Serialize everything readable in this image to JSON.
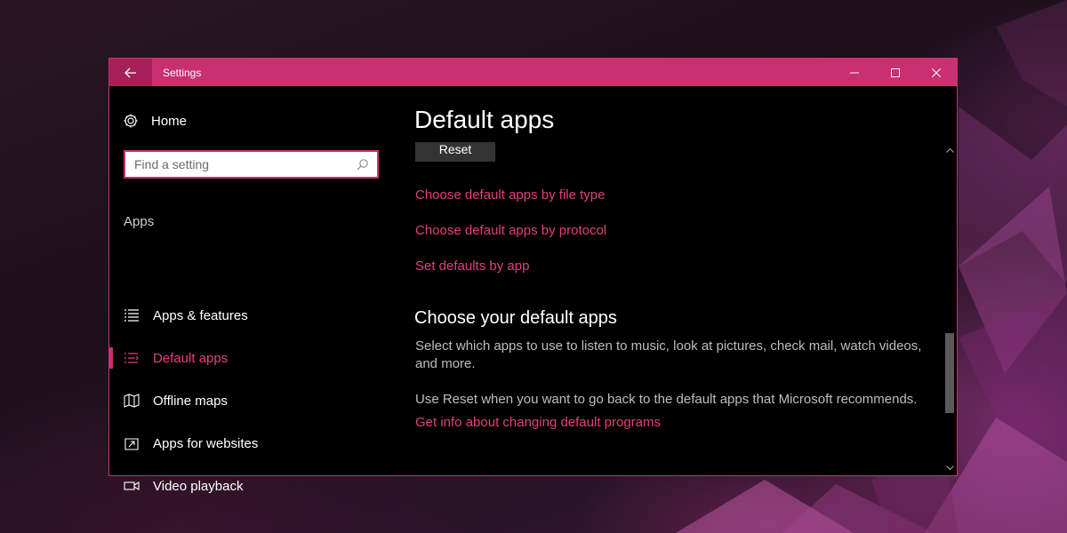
{
  "window": {
    "title": "Settings"
  },
  "sidebar": {
    "home_label": "Home",
    "search_placeholder": "Find a setting",
    "section_label": "Apps",
    "items": [
      {
        "label": "Apps & features",
        "icon": "list-icon",
        "active": false
      },
      {
        "label": "Default apps",
        "icon": "default-apps-icon",
        "active": true
      },
      {
        "label": "Offline maps",
        "icon": "map-icon",
        "active": false
      },
      {
        "label": "Apps for websites",
        "icon": "open-external-icon",
        "active": false
      },
      {
        "label": "Video playback",
        "icon": "video-icon",
        "active": false
      }
    ]
  },
  "main": {
    "title": "Default apps",
    "reset_label": "Reset",
    "links": [
      "Choose default apps by file type",
      "Choose default apps by protocol",
      "Set defaults by app"
    ],
    "subheading": "Choose your default apps",
    "description": "Select which apps to use to listen to music, look at pictures, check mail, watch videos, and more.",
    "reset_note": "Use Reset when you want to go back to the default apps that Microsoft recommends.",
    "info_link": "Get info about changing default programs"
  },
  "colors": {
    "accent": "#c8306f",
    "link": "#e0407d",
    "background": "#000000"
  }
}
